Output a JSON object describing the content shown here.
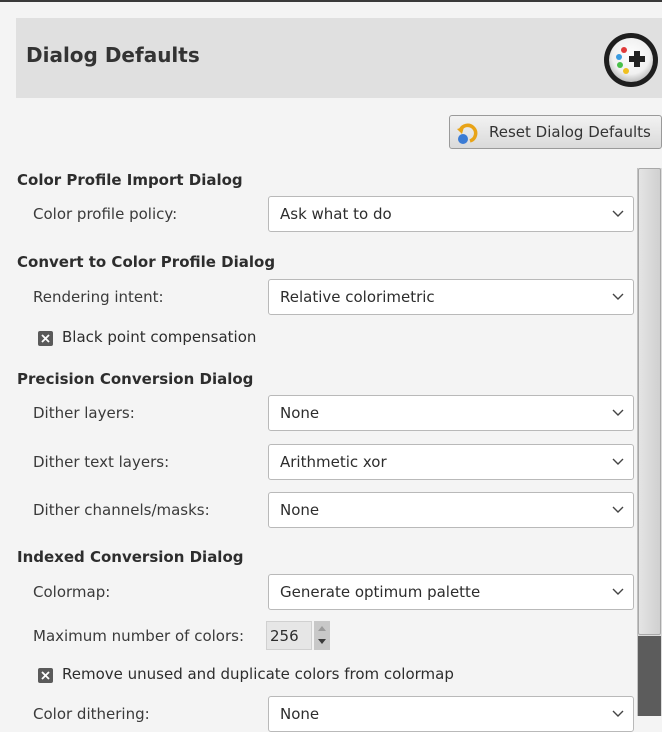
{
  "header": {
    "title": "Dialog Defaults",
    "icon": "gimp-prefs-icon"
  },
  "reset_button": {
    "label": "Reset Dialog Defaults",
    "icon": "reset-icon"
  },
  "sections": {
    "color_profile_import": {
      "title": "Color Profile Import Dialog",
      "policy_label": "Color profile policy:",
      "policy_value": "Ask what to do"
    },
    "convert_to_profile": {
      "title": "Convert to Color Profile Dialog",
      "intent_label": "Rendering intent:",
      "intent_value": "Relative colorimetric",
      "black_point_label": "Black point compensation",
      "black_point_checked": true
    },
    "precision_conversion": {
      "title": "Precision Conversion Dialog",
      "dither_layers_label": "Dither layers:",
      "dither_layers_value": "None",
      "dither_text_label": "Dither text layers:",
      "dither_text_value": "Arithmetic xor",
      "dither_channels_label": "Dither channels/masks:",
      "dither_channels_value": "None"
    },
    "indexed_conversion": {
      "title": "Indexed Conversion Dialog",
      "colormap_label": "Colormap:",
      "colormap_value": "Generate optimum palette",
      "max_colors_label": "Maximum number of colors:",
      "max_colors_value": "256",
      "remove_unused_label": "Remove unused and duplicate colors from colormap",
      "remove_unused_checked": true,
      "color_dithering_label": "Color dithering:",
      "color_dithering_value": "None"
    }
  },
  "colors": {
    "header_bg": "#e0e0e0",
    "panel_bg": "#f4f4f4",
    "scrollbar_dark": "#5c5c5c"
  }
}
